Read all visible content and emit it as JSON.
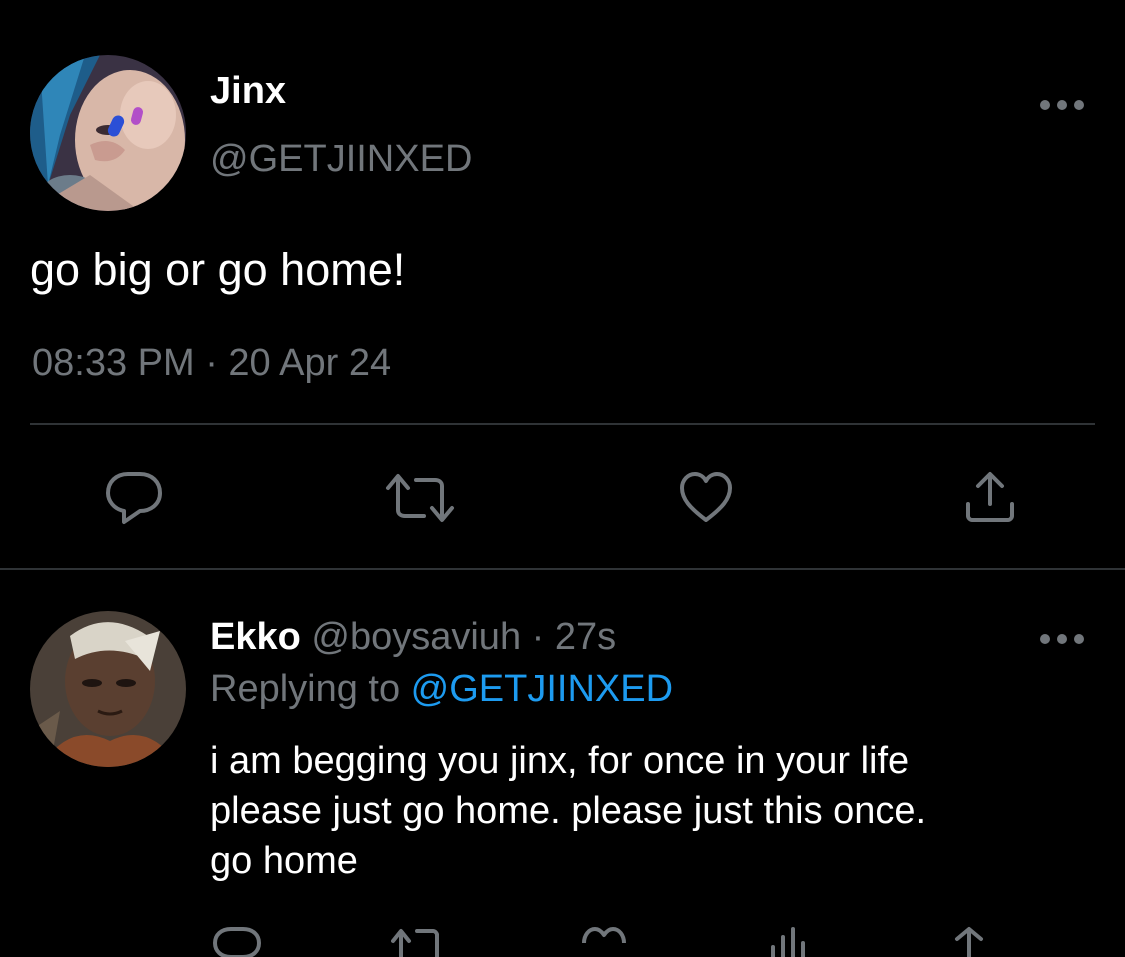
{
  "main_tweet": {
    "name": "Jinx",
    "handle": "@GETJIINXED",
    "text": "go big or go home!",
    "timestamp": "08:33 PM · 20 Apr 24",
    "avatar_icon": "jinx-avatar",
    "actions": [
      "reply-icon",
      "retweet-icon",
      "like-icon",
      "share-icon"
    ]
  },
  "reply_tweet": {
    "name": "Ekko",
    "handle": "@boysaviuh",
    "separator": " · ",
    "age": "27s",
    "replying_label": "Replying to ",
    "replying_to": "@GETJIINXED",
    "text_lines": [
      "i am begging you jinx, for once in your life",
      "please just go home. please just this once.",
      "go home"
    ],
    "avatar_icon": "ekko-avatar",
    "actions": [
      "reply-icon",
      "retweet-icon",
      "like-icon",
      "views-icon",
      "share-icon"
    ]
  },
  "colors": {
    "background": "#000000",
    "text": "#ffffff",
    "muted": "#71767b",
    "accent": "#1d9bf0",
    "divider": "#2f3336"
  }
}
